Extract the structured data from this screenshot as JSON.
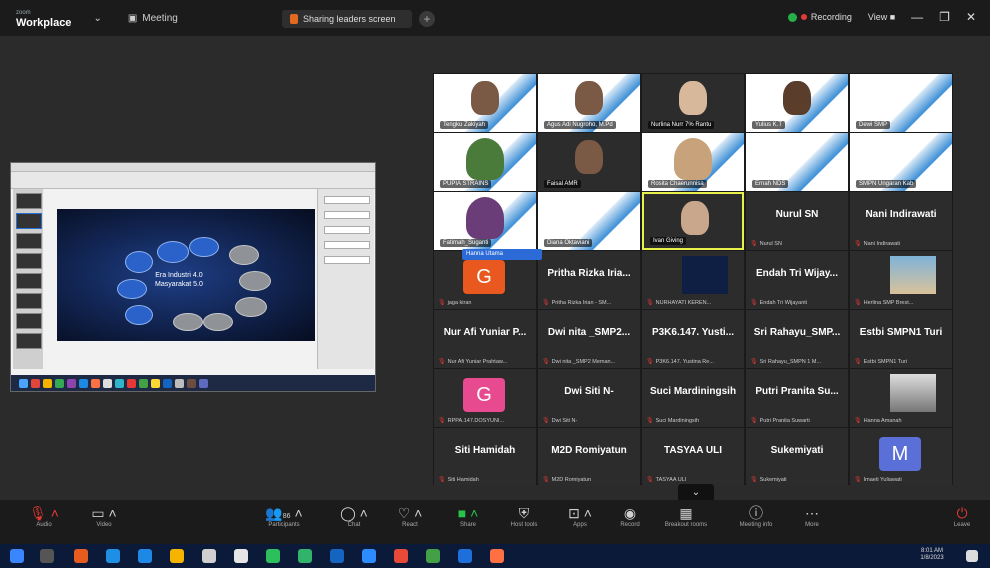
{
  "titlebar": {
    "brand_small": "zoom",
    "brand": "Workplace",
    "meeting_label": "Meeting",
    "tab_label": "Sharing leaders screen",
    "add_tab": "+",
    "recording": "Recording",
    "view_label": "View",
    "minimize": "—",
    "maximize": "❐",
    "close": "✕"
  },
  "slide": {
    "center_line1": "Era Industri 4.0",
    "center_line2": "Masyarakat 5.0"
  },
  "gallery": {
    "row1": [
      "Tengku Zakiyah",
      "Agus Adi Nugroho, M.Pd",
      "Nurlina Nurr 7% Rantu",
      "Yulius K.T",
      "Dewi SMP"
    ],
    "row2": [
      "PUPIA STRAINS",
      "Faisal AMR",
      "Rosita Chaerunnisa",
      "Ernah NDS",
      "SMPN Ungaran Kab"
    ],
    "row3_names": [
      "Fatimah_Suganti",
      "Diana Oktaviani",
      "Ivan Giving"
    ],
    "nurul_sn": "Nurul SN",
    "nani": "Nani Indirawati",
    "nani_sub": "Nani Indirawati",
    "pill": "Hanna Utama",
    "avatar_g": "G",
    "avatar_m": "M",
    "row4": [
      {
        "big": "",
        "sub": "jaga kiran"
      },
      {
        "big": "Pritha Rizka Iria...",
        "sub": "Pritha Rizka Irian - SM..."
      },
      {
        "big": "",
        "sub": "NURHAYATI KEREN..."
      },
      {
        "big": "Endah Tri Wijay...",
        "sub": "Endah Tri Wijayanti"
      },
      {
        "big": "",
        "sub": "Herlina SMP Brest..."
      }
    ],
    "row5": [
      {
        "big": "Nur Afi Yuniar P...",
        "sub": "Nur Afi Yuniar Prahtaw..."
      },
      {
        "big": "Dwi nita _SMP2...",
        "sub": "Dwi nita _SMP2 Meman..."
      },
      {
        "big": "P3K6.147. Yusti...",
        "sub": "P3K6.147. Yustina Re..."
      },
      {
        "big": "Sri Rahayu_SMP...",
        "sub": "Sri Rahayu_SMPN 1 M..."
      },
      {
        "big": "Estbi SMPN1 Turi",
        "sub": "Estbi SMPN1 Turi"
      }
    ],
    "row6": [
      {
        "big": "",
        "sub": "RPPA.147.DOSYUNI..."
      },
      {
        "big": "Dwi Siti N-",
        "sub": "Dwi Siti N-"
      },
      {
        "big": "Suci Mardiningsih",
        "sub": "Suci Mardiningsih"
      },
      {
        "big": "Putri Pranita Su...",
        "sub": "Putri Pranita Suwarti"
      },
      {
        "big": "",
        "sub": "Hanna Amanah"
      }
    ],
    "row7": [
      {
        "big": "Siti Hamidah",
        "sub": "Siti Hamidah"
      },
      {
        "big": "M2D Romiyatun",
        "sub": "M2D Romiyatun"
      },
      {
        "big": "TASYAA ULI",
        "sub": "TASYAA ULI"
      },
      {
        "big": "Sukemiyati",
        "sub": "Sukemiyati"
      },
      {
        "big": "",
        "sub": "Imaeti Yuliawati"
      }
    ],
    "collapse": "⌄"
  },
  "controls": {
    "audio": "Audio",
    "video": "Video",
    "participants": "Participants",
    "participant_count": "86",
    "chat": "Chat",
    "react": "React",
    "share": "Share",
    "host_tools": "Host tools",
    "apps": "Apps",
    "record": "Record",
    "breakout": "Breakout rooms",
    "meeting_info": "Meeting info",
    "more": "More",
    "leave": "Leave"
  },
  "taskbar": {
    "time": "8:01 AM",
    "date": "1/8/2023"
  },
  "colors": {
    "accent": "#27c34b",
    "danger": "#e53935",
    "highlight": "#e8f04a",
    "pill": "#2c6ad8"
  }
}
